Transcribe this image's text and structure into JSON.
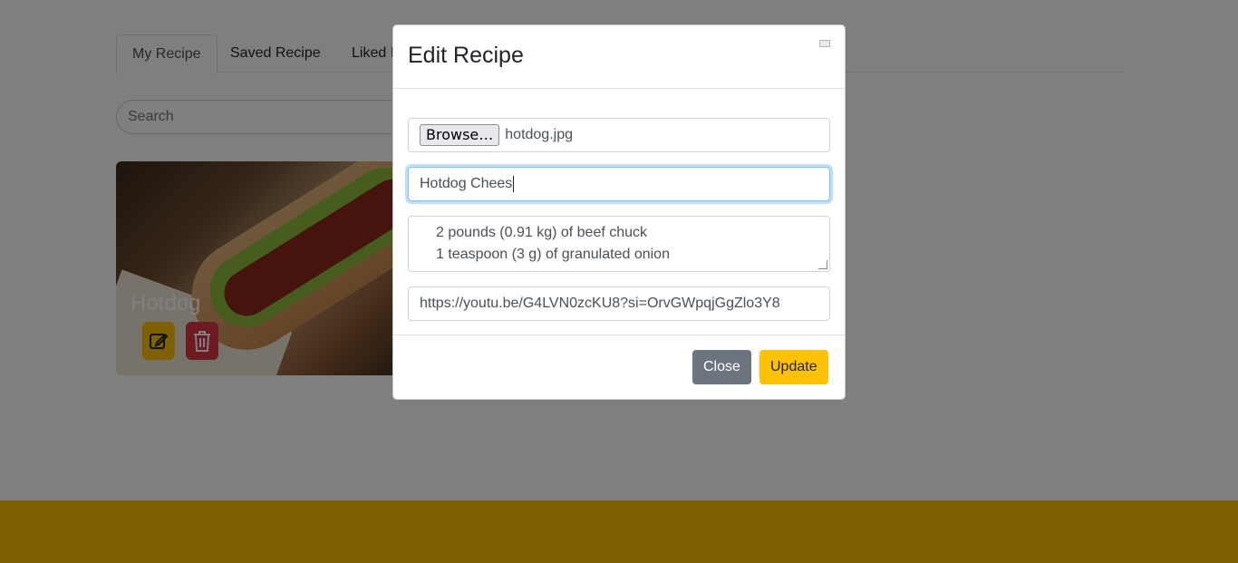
{
  "tabs": [
    {
      "label": "My Recipe",
      "active": true
    },
    {
      "label": "Saved Recipe",
      "active": false
    },
    {
      "label": "Liked I",
      "active": false
    }
  ],
  "search": {
    "placeholder": "Search"
  },
  "card": {
    "title": "Hotdog",
    "edit_icon": "edit-square-icon",
    "delete_icon": "trash-icon"
  },
  "colors": {
    "accent": "#ffc107",
    "danger": "#dc3545",
    "secondary": "#6c757d",
    "focus": "#80bdff"
  },
  "modal": {
    "title": "Edit Recipe",
    "close_icon": "close-icon",
    "file": {
      "button_label": "Browse…",
      "filename": "hotdog.jpg"
    },
    "name_value": "Hotdog Chees",
    "ingredients": [
      "2 pounds (0.91 kg) of beef chuck",
      "1 teaspoon (3 g) of granulated onion"
    ],
    "video_url": "https://youtu.be/G4LVN0zcKU8?si=OrvGWpqjGgZlo3Y8",
    "close_label": "Close",
    "update_label": "Update"
  }
}
